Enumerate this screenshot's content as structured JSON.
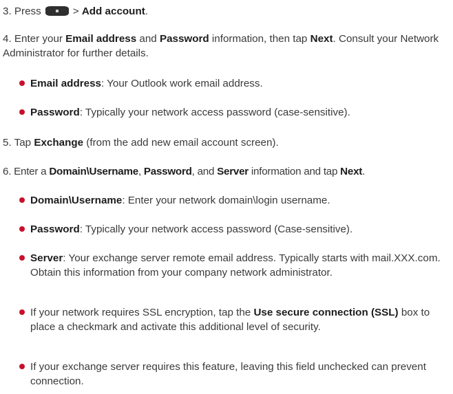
{
  "step3": {
    "prefix": "3. Press",
    "key_icon": "menu-key-icon",
    "mid": "> ",
    "add_account": "Add account",
    "end": "."
  },
  "step4": {
    "p1": "4. Enter your ",
    "email_address": "Email address",
    "p2": " and ",
    "password": "Password",
    "p3": " information, then tap ",
    "next": "Next",
    "p4": ". Consult your Network Administrator for further details.",
    "bullets": [
      {
        "label": "Email address",
        "text": ": Your Outlook work email address."
      },
      {
        "label": "Password",
        "text": ": Typically your network access password (case-sensitive)."
      }
    ]
  },
  "step5": {
    "p1": "5. Tap ",
    "exchange": "Exchange",
    "p2": " (from the add new email account screen)."
  },
  "step6": {
    "p1": "6. Enter a ",
    "domain_username": "Domain\\Username",
    "p2": ", ",
    "password": "Password",
    "p3": ", and ",
    "server": "Server",
    "p4": " information and tap ",
    "next": "Next",
    "p5": ".",
    "bullets": [
      {
        "label": "Domain\\Username",
        "text": ": Enter your network domain\\login username."
      },
      {
        "label": "Password",
        "text": ": Typically your network access password (Case-sensitive)."
      },
      {
        "label": "Server",
        "text": ": Your exchange server remote email address. Typically starts with mail.XXX.com. Obtain this information from your company network administrator."
      }
    ],
    "ssl_bullet": {
      "pre": "If your network requires SSL encryption, tap the ",
      "label": "Use secure connection (SSL)",
      "post": " box to place a checkmark and activate this additional level of security."
    },
    "last_bullet": "If your exchange server requires this feature, leaving this field unchecked can prevent connection."
  },
  "colors": {
    "bullet": "#c8102e",
    "text": "#3a3a3a",
    "bold": "#1c1c1c"
  }
}
